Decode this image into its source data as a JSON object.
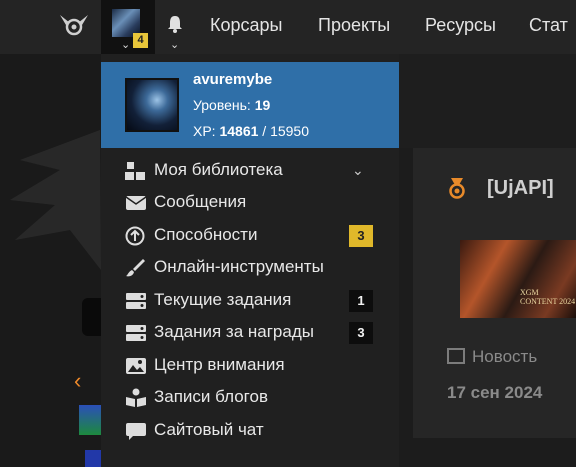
{
  "navbar": {
    "links": [
      "Корсары",
      "Проекты",
      "Ресурсы",
      "Стат"
    ],
    "avatar_badge": "4"
  },
  "user_menu": {
    "username": "avuremybe",
    "level_label": "Уровень:",
    "level_value": "19",
    "xp_label": "XP:",
    "xp_current": "14861",
    "xp_separator": "/",
    "xp_max": "15950",
    "items": [
      {
        "label": "Моя библиотека",
        "icon": "library-icon",
        "expandable": true
      },
      {
        "label": "Сообщения",
        "icon": "envelope-icon"
      },
      {
        "label": "Способности",
        "icon": "arrow-circle-up-icon",
        "count": "3",
        "count_style": "yellow"
      },
      {
        "label": "Онлайн-инструменты",
        "icon": "brush-icon"
      },
      {
        "label": "Текущие задания",
        "icon": "tasks-icon",
        "count": "1",
        "count_style": "dark"
      },
      {
        "label": "Задания за награды",
        "icon": "tasks-icon",
        "count": "3",
        "count_style": "dark"
      },
      {
        "label": "Центр внимания",
        "icon": "image-icon"
      },
      {
        "label": "Записи блогов",
        "icon": "book-reader-icon"
      },
      {
        "label": "Сайтовый чат",
        "icon": "chat-bubble-icon"
      }
    ]
  },
  "article": {
    "title": "[UjAPI]",
    "thumb_text": "XGM CONTENT 2024",
    "type_label": "Новость",
    "date": "17 сен 2024"
  },
  "colors": {
    "accent_blue": "#2f6fa8",
    "badge_yellow": "#e0b82a",
    "orange": "#f08a2a"
  }
}
